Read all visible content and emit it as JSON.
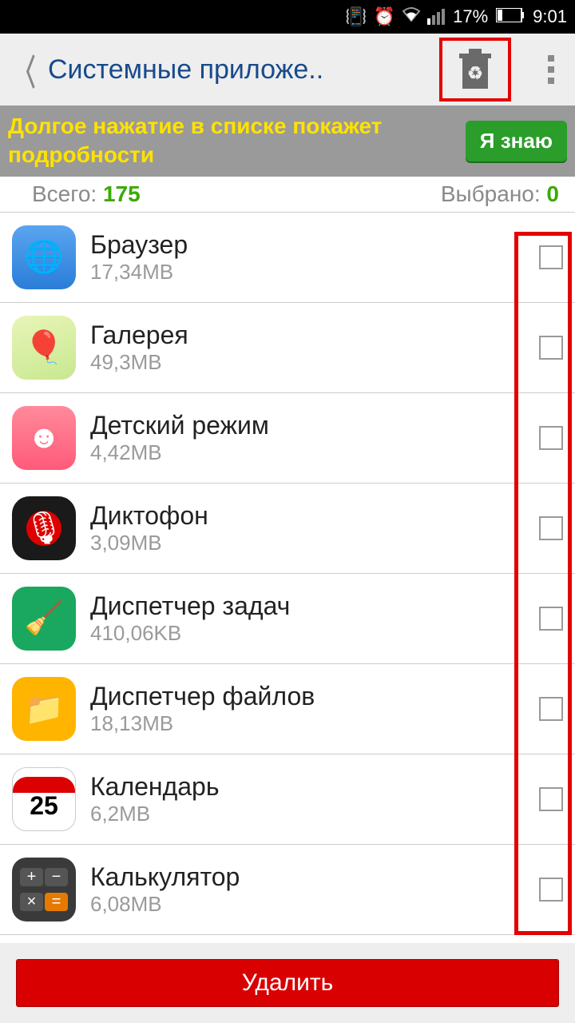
{
  "status": {
    "battery": "17%",
    "time": "9:01"
  },
  "header": {
    "title": "Системные приложе.."
  },
  "hint": {
    "text": "Долгое нажатие в списке покажет подробности",
    "button": "Я знаю"
  },
  "counts": {
    "totalLabel": "Всего: ",
    "totalValue": "175",
    "selectedLabel": "Выбрано: ",
    "selectedValue": "0"
  },
  "apps": [
    {
      "name": "Браузер",
      "size": "17,34MB",
      "iconClass": "ic-browser",
      "glyph": "🌐"
    },
    {
      "name": "Галерея",
      "size": "49,3MB",
      "iconClass": "ic-gallery",
      "glyph": "🎈"
    },
    {
      "name": "Детский режим",
      "size": "4,42MB",
      "iconClass": "ic-kids",
      "glyph": "☻"
    },
    {
      "name": "Диктофон",
      "size": "3,09MB",
      "iconClass": "ic-recorder",
      "glyph": "🎤"
    },
    {
      "name": "Диспетчер задач",
      "size": "410,06KB",
      "iconClass": "ic-tasks",
      "glyph": "🧹"
    },
    {
      "name": "Диспетчер файлов",
      "size": "18,13MB",
      "iconClass": "ic-files",
      "glyph": "📁"
    },
    {
      "name": "Календарь",
      "size": "6,2MB",
      "iconClass": "ic-calendar",
      "glyph": "25"
    },
    {
      "name": "Калькулятор",
      "size": "6,08MB",
      "iconClass": "ic-calc",
      "glyph": "calc"
    }
  ],
  "footer": {
    "delete": "Удалить"
  }
}
